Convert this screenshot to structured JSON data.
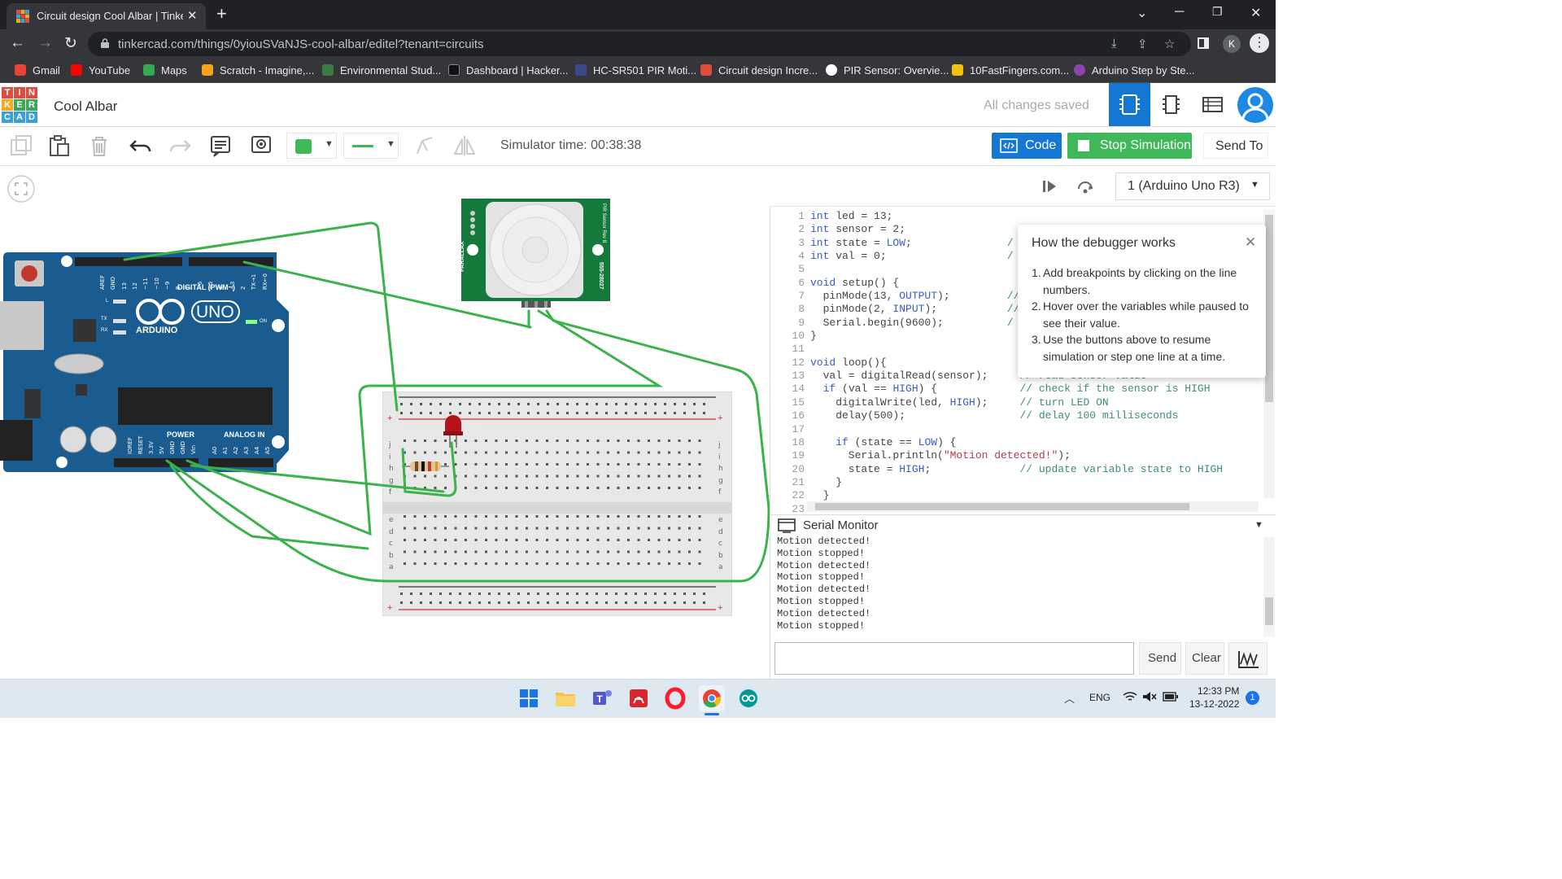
{
  "browser": {
    "tab_title": "Circuit design Cool Albar | Tinker",
    "url": "tinkercad.com/things/0yiouSVaNJS-cool-albar/editel?tenant=circuits",
    "profile_initial": "K",
    "bookmarks": [
      {
        "label": "Gmail",
        "color": "#ea4335"
      },
      {
        "label": "YouTube",
        "color": "#ff0000"
      },
      {
        "label": "Maps",
        "color": "#34a853"
      },
      {
        "label": "Scratch - Imagine,...",
        "color": "#f7a31c"
      },
      {
        "label": "Environmental Stud...",
        "color": "#3a7d44"
      },
      {
        "label": "Dashboard | Hacker...",
        "color": "#111111"
      },
      {
        "label": "HC-SR501 PIR Moti...",
        "color": "#3c4a8c"
      },
      {
        "label": "Circuit design Incre...",
        "color": "#e14b3b"
      },
      {
        "label": "PIR Sensor: Overvie...",
        "color": "#ffffff"
      },
      {
        "label": "10FastFingers.com...",
        "color": "#f4c20d"
      },
      {
        "label": "Arduino Step by Ste...",
        "color": "#8e44ad"
      }
    ]
  },
  "app": {
    "logo_letters": [
      "T",
      "I",
      "N",
      "K",
      "E",
      "R",
      "C",
      "A",
      "D"
    ],
    "design_name": "Cool Albar",
    "save_status": "All changes saved",
    "simulator_time": "Simulator time: 00:38:38",
    "code_button": "Code",
    "stop_button": "Stop Simulation",
    "send_to_button": "Send To"
  },
  "code_panel": {
    "device": "1 (Arduino Uno R3)",
    "line_numbers": [
      "1",
      "2",
      "3",
      "4",
      "5",
      "6",
      "7",
      "8",
      "9",
      "10",
      "11",
      "12",
      "13",
      "14",
      "15",
      "16",
      "17",
      "18",
      "19",
      "20",
      "21",
      "22",
      "23"
    ],
    "lines": [
      {
        "code": "int led = 13;",
        "comment": ""
      },
      {
        "code": "int sensor = 2;",
        "comment": ""
      },
      {
        "code": "int state = LOW;",
        "comment": "/"
      },
      {
        "code": "int val = 0;",
        "comment": "/"
      },
      {
        "code": "",
        "comment": ""
      },
      {
        "code": "void setup() {",
        "comment": ""
      },
      {
        "code": "  pinMode(13, OUTPUT);",
        "comment": "//"
      },
      {
        "code": "  pinMode(2, INPUT);",
        "comment": "// ini"
      },
      {
        "code": "  Serial.begin(9600);",
        "comment": "/"
      },
      {
        "code": "}",
        "comment": ""
      },
      {
        "code": "",
        "comment": ""
      },
      {
        "code": "void loop(){",
        "comment": ""
      },
      {
        "code": "  val = digitalRead(sensor);",
        "comment": "// read sensor value"
      },
      {
        "code": "  if (val == HIGH) {",
        "comment": "// check if the sensor is HIGH"
      },
      {
        "code": "    digitalWrite(led, HIGH);",
        "comment": "// turn LED ON"
      },
      {
        "code": "    delay(500);",
        "comment": "// delay 100 milliseconds"
      },
      {
        "code": "",
        "comment": ""
      },
      {
        "code": "    if (state == LOW) {",
        "comment": ""
      },
      {
        "code": "      Serial.println(\"Motion detected!\");",
        "comment": ""
      },
      {
        "code": "      state = HIGH;",
        "comment": "// update variable state to HIGH"
      },
      {
        "code": "    }",
        "comment": ""
      },
      {
        "code": "  }",
        "comment": ""
      },
      {
        "code": "",
        "comment": ""
      }
    ],
    "debugger_popup": {
      "title": "How the debugger works",
      "steps": [
        "Add breakpoints by clicking on the line numbers.",
        "Hover over the variables while paused to see their value.",
        "Use the buttons above to resume simulation or step one line at a time."
      ]
    }
  },
  "serial_monitor": {
    "title": "Serial Monitor",
    "lines": [
      "Motion detected!",
      "Motion stopped!",
      "Motion detected!",
      "Motion stopped!",
      "Motion detected!",
      "Motion stopped!",
      "Motion detected!",
      "Motion stopped!"
    ],
    "input_value": "",
    "send_label": "Send",
    "clear_label": "Clear"
  },
  "board": {
    "brand": "ARDUINO",
    "model": "UNO",
    "digital_label": "DIGITAL (PWM~)",
    "power_label": "POWER",
    "analog_label": "ANALOG IN",
    "top_pins": [
      "AREF",
      "GND",
      "13",
      "12",
      "~11",
      "~10",
      "~9",
      "8",
      "7",
      "~6",
      "~5",
      "4",
      "~3",
      "2",
      "TX→1",
      "RX←0"
    ],
    "bottom_power_pins": [
      "IOREF",
      "RESET",
      "3.3V",
      "5V",
      "GND",
      "GND",
      "Vin"
    ],
    "analog_pins": [
      "A0",
      "A1",
      "A2",
      "A3",
      "A4",
      "A5"
    ],
    "tx_label": "TX",
    "rx_label": "RX",
    "l_label": "L",
    "on_label": "ON"
  },
  "pir_sensor": {
    "side_label_left": "PARALLAX",
    "side_label_right": "555-28027",
    "top_label_right": "PIR Sensor Rev B"
  },
  "breadboard": {
    "row_letters_top": [
      "j",
      "i",
      "h",
      "g",
      "f"
    ],
    "row_letters_bottom": [
      "e",
      "d",
      "c",
      "b",
      "a"
    ]
  },
  "taskbar": {
    "language": "ENG",
    "time": "12:33 PM",
    "date": "13-12-2022",
    "notification_count": "1"
  },
  "colors": {
    "wire": "#3bb34a",
    "arduino_blue": "#1a5c8f",
    "pir_green": "#137a3c",
    "stop_green": "#3fb859",
    "code_blue": "#1477d4"
  }
}
